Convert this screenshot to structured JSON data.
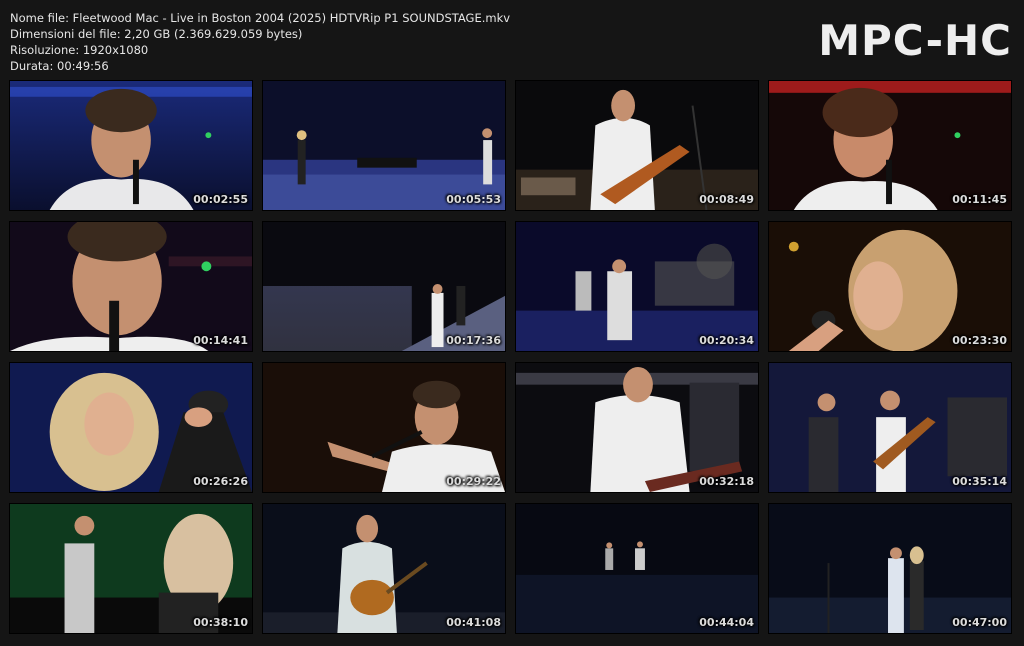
{
  "info": {
    "file_name": "Nome file: Fleetwood Mac - Live in Boston 2004 (2025) HDTVRip P1 SOUNDSTAGE.mkv",
    "file_size": "Dimensioni del file: 2,20 GB (2.369.629.059 bytes)",
    "resolution": "Risoluzione: 1920x1080",
    "duration": "Durata: 00:49:56"
  },
  "logo": "MPC-HC",
  "thumbnails": [
    {
      "time": "00:02:55"
    },
    {
      "time": "00:05:53"
    },
    {
      "time": "00:08:49"
    },
    {
      "time": "00:11:45"
    },
    {
      "time": "00:14:41"
    },
    {
      "time": "00:17:36"
    },
    {
      "time": "00:20:34"
    },
    {
      "time": "00:23:30"
    },
    {
      "time": "00:26:26"
    },
    {
      "time": "00:29:22"
    },
    {
      "time": "00:32:18"
    },
    {
      "time": "00:35:14"
    },
    {
      "time": "00:38:10"
    },
    {
      "time": "00:41:08"
    },
    {
      "time": "00:44:04"
    },
    {
      "time": "00:47:00"
    }
  ]
}
